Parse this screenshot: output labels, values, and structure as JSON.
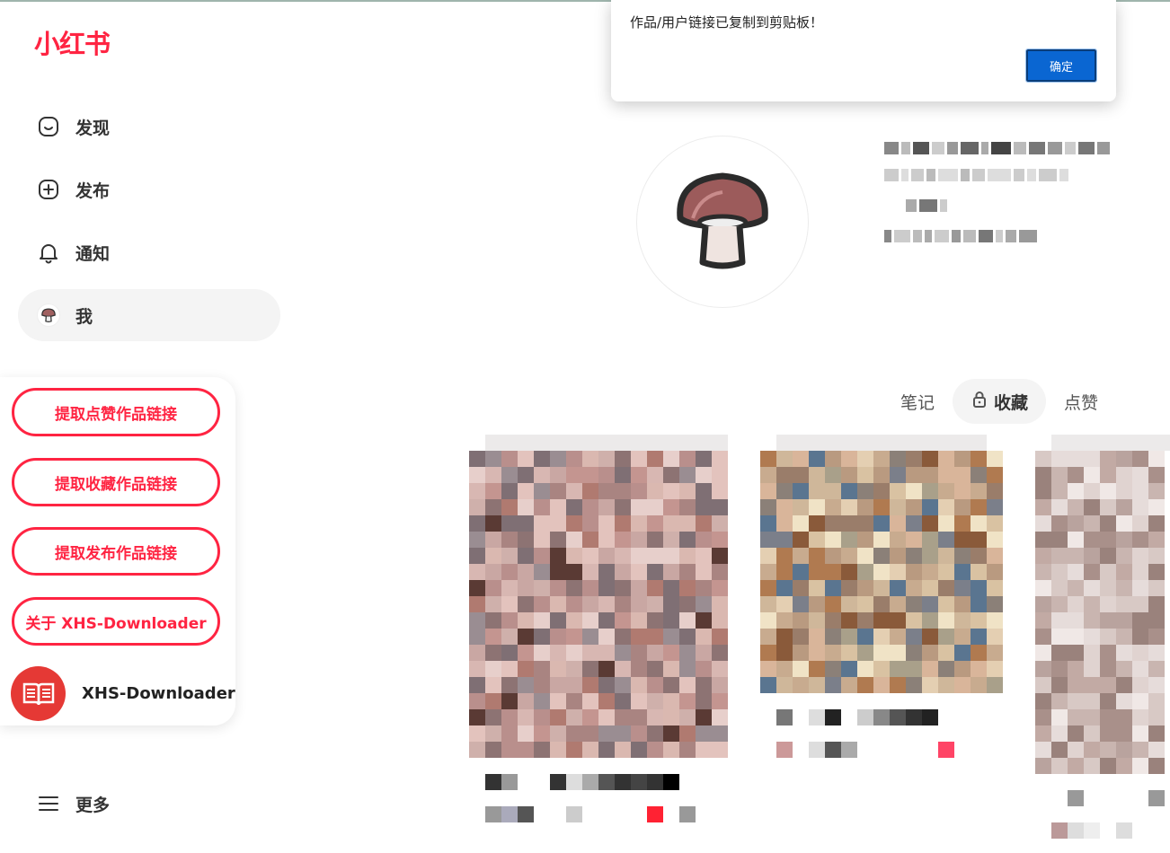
{
  "app": {
    "logo": "小红书"
  },
  "nav": [
    {
      "label": "发现",
      "icon": "home-icon"
    },
    {
      "label": "发布",
      "icon": "plus-square-icon"
    },
    {
      "label": "通知",
      "icon": "bell-icon"
    },
    {
      "label": "我",
      "icon": "mushroom-avatar-icon",
      "active": true
    }
  ],
  "more": {
    "label": "更多",
    "icon": "menu-icon"
  },
  "plugin": {
    "buttons": [
      "提取点赞作品链接",
      "提取收藏作品链接",
      "提取发布作品链接",
      "关于 XHS-Downloader"
    ],
    "name": "XHS-Downloader",
    "icon": "book-icon",
    "accent": "#ff2442",
    "circle_color": "#e53935"
  },
  "profile": {
    "avatar_icon": "mushroom-avatar-icon"
  },
  "tabs": {
    "items": [
      "笔记",
      "收藏",
      "点赞"
    ],
    "active": "收藏"
  },
  "dialog": {
    "message": "作品/用户链接已复制到剪贴板！",
    "ok_label": "确定",
    "button_color": "#0a66d2"
  }
}
